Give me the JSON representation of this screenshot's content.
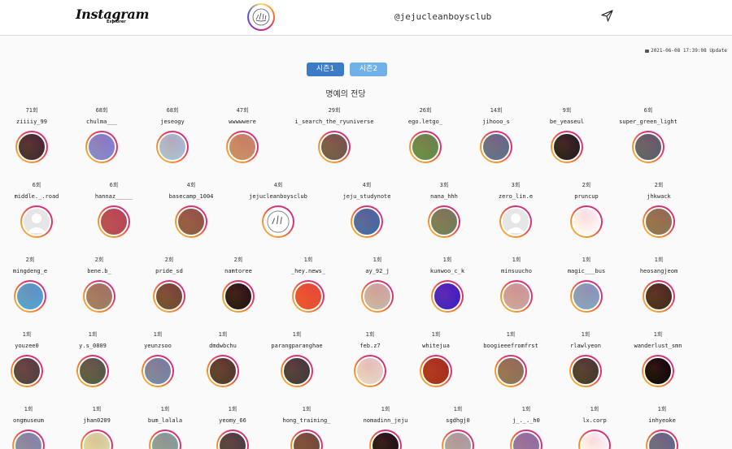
{
  "header": {
    "logo_text": "Instagram",
    "logo_sub": "Explorer",
    "handle": "@jejucleanboysclub"
  },
  "update_text": "2021-06-08 17:39:08 Update",
  "seasons": [
    {
      "label": "시즌1",
      "active": true
    },
    {
      "label": "시즌2",
      "active": false
    }
  ],
  "hall_of_fame_title": "명예의 전당",
  "rows": [
    [
      {
        "count": "71회",
        "name": "ziiiiy_99",
        "photo": "#3a2a2e"
      },
      {
        "count": "68회",
        "name": "chulma___",
        "photo": "#7d86d6"
      },
      {
        "count": "68회",
        "name": "jeseogy",
        "photo": "#a7c2d8"
      },
      {
        "count": "47회",
        "name": "wwwwwere",
        "photo": "#c58d6a"
      },
      {
        "count": "29회",
        "name": "i_search_the_ryuniverse",
        "photo": "#6b5a4a"
      },
      {
        "count": "26회",
        "name": "ego.letgo_",
        "photo": "#5d8e4a"
      },
      {
        "count": "14회",
        "name": "jihooo_s",
        "photo": "#5a6f8d"
      },
      {
        "count": "9회",
        "name": "be_yeaseul",
        "photo": "#1c1c1c"
      },
      {
        "count": "6회",
        "name": "super_green_light",
        "photo": "#56606c"
      }
    ],
    [
      {
        "count": "6회",
        "name": "middle._.road",
        "photo": "blank"
      },
      {
        "count": "6회",
        "name": "hannaz_____",
        "photo": "#b34a55"
      },
      {
        "count": "4회",
        "name": "basecamp_1004",
        "photo": "#8a5a44"
      },
      {
        "count": "4회",
        "name": "jejucleanboysclub",
        "photo": "logo"
      },
      {
        "count": "4회",
        "name": "jeju_studynote",
        "photo": "#3e6aa8"
      },
      {
        "count": "3회",
        "name": "nana_hhh",
        "photo": "#6e7f59"
      },
      {
        "count": "3회",
        "name": "zero_lin.e",
        "photo": "blank"
      },
      {
        "count": "2회",
        "name": "pruncup",
        "photo": "#ffffff"
      },
      {
        "count": "2회",
        "name": "jhkwack",
        "photo": "#8a7450"
      }
    ],
    [
      {
        "count": "2회",
        "name": "mingdeng_e",
        "photo": "#4aa3d8"
      },
      {
        "count": "2회",
        "name": "bene.b_",
        "photo": "#9a7d64"
      },
      {
        "count": "2회",
        "name": "pride_sd",
        "photo": "#6a4b32"
      },
      {
        "count": "2회",
        "name": "namtoree",
        "photo": "#1b1410"
      },
      {
        "count": "1회",
        "name": "_hey.news_",
        "photo": "#e8502f"
      },
      {
        "count": "1회",
        "name": "ay_92_j",
        "photo": "#c9b6aa"
      },
      {
        "count": "1회",
        "name": "kunwoo_c_k",
        "photo": "#3a1ec9"
      },
      {
        "count": "1회",
        "name": "minsuucho",
        "photo": "#c9a6a0"
      },
      {
        "count": "1회",
        "name": "magic___bus",
        "photo": "#7fa3c7"
      },
      {
        "count": "1회",
        "name": "heosangjeom",
        "photo": "#3e2c1c"
      }
    ],
    [
      {
        "count": "1회",
        "name": "youzee0",
        "photo": "#4d4040"
      },
      {
        "count": "1회",
        "name": "y.s_0809",
        "photo": "#4c5a46"
      },
      {
        "count": "1회",
        "name": "yeunzsoo",
        "photo": "#6f88a8"
      },
      {
        "count": "1회",
        "name": "dmdwbchu",
        "photo": "#4b3a2a"
      },
      {
        "count": "1회",
        "name": "parangparanghae",
        "photo": "#3a3a3a"
      },
      {
        "count": "1회",
        "name": "feb.z7",
        "photo": "#e6d8cc"
      },
      {
        "count": "1회",
        "name": "whitejua",
        "photo": "#a43018"
      },
      {
        "count": "1회",
        "name": "boogieeefromfrst",
        "photo": "#8a7558"
      },
      {
        "count": "1회",
        "name": "rlawlyeon",
        "photo": "#3d3a2c"
      },
      {
        "count": "1회",
        "name": "wanderlust_smn",
        "photo": "#050505"
      }
    ],
    [
      {
        "count": "1회",
        "name": "ongmuseum",
        "photo": "#7c8fb0"
      },
      {
        "count": "1회",
        "name": "jhan0209",
        "photo": "#d8e0a8"
      },
      {
        "count": "1회",
        "name": "bum_lalala",
        "photo": "#7fa6a0"
      },
      {
        "count": "1회",
        "name": "yeomy_66",
        "photo": "#3f3f3f"
      },
      {
        "count": "1회",
        "name": "hong_training_",
        "photo": "#6a4e38"
      },
      {
        "count": "1회",
        "name": "nomadinn_jeju",
        "photo": "#111111"
      },
      {
        "count": "1회",
        "name": "sgdhgj0",
        "photo": "#a8a8a8"
      },
      {
        "count": "1회",
        "name": "j_._._h0",
        "photo": "#8a76a8"
      },
      {
        "count": "1회",
        "name": "lx.corp",
        "photo": "#ffffff"
      },
      {
        "count": "1회",
        "name": "inhyeoke",
        "photo": "#5a6c88"
      }
    ]
  ]
}
